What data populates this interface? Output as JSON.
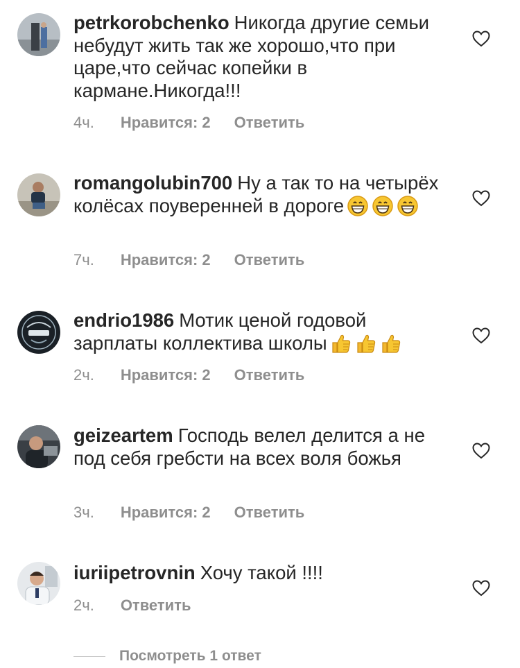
{
  "comments": [
    {
      "username": "petrkorobchenko",
      "text": "Никогда другие семьи небудут жить так же хорошо,что при царе,что сейчас копейки в кармане.Никогда!!!",
      "time": "4ч.",
      "likes": "Нравится: 2",
      "reply": "Ответить",
      "emoji": []
    },
    {
      "username": "romangolubin700",
      "text": "Ну а так то на четырёх колёсах поуверенней в дороге",
      "time": "7ч.",
      "likes": "Нравится: 2",
      "reply": "Ответить",
      "emoji": [
        "grinning-face",
        "grinning-face",
        "grinning-face"
      ]
    },
    {
      "username": "endrio1986",
      "text": "Мотик ценой годовой зарплаты коллектива школы",
      "time": "2ч.",
      "likes": "Нравится: 2",
      "reply": "Ответить",
      "emoji": [
        "thumbs-up",
        "thumbs-up",
        "thumbs-up"
      ]
    },
    {
      "username": "geizeartem",
      "text": "Господь велел делится  а не под себя гребсти на всех воля божья",
      "time": "3ч.",
      "likes": "Нравится: 2",
      "reply": "Ответить",
      "emoji": []
    },
    {
      "username": "iuriipetrovnin",
      "text": "Хочу такой !!!!",
      "time": "2ч.",
      "likes": "",
      "reply": "Ответить",
      "emoji": []
    }
  ],
  "view_replies": "Посмотреть 1 ответ",
  "icons": {
    "like": "heart-outline-icon"
  },
  "colors": {
    "text": "#262626",
    "secondary": "#8e8e8e",
    "divider": "#c7c7c7"
  }
}
